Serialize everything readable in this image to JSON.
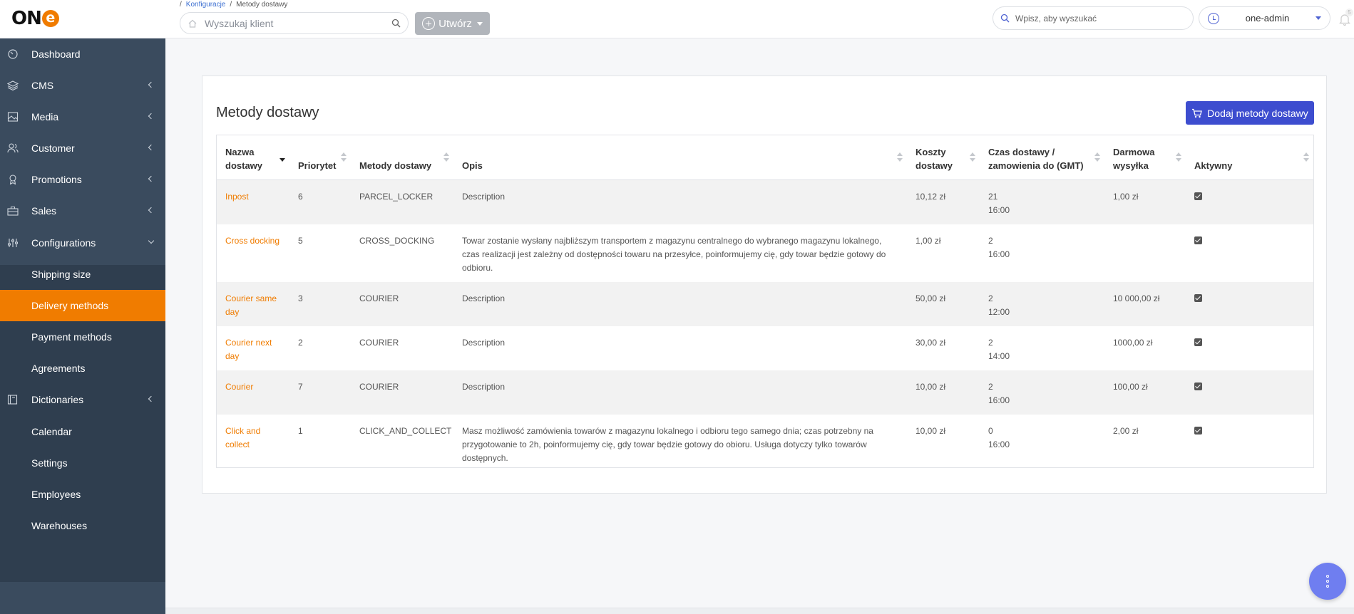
{
  "brand": {
    "logo_text": "ON",
    "logo_e": "e",
    "accent": "#f07c00",
    "primary": "#3d4dcf"
  },
  "breadcrumb": {
    "sep1": "/",
    "link": "Konfiguracje",
    "sep2": "/",
    "current": "Metody dostawy"
  },
  "header": {
    "client_search_placeholder": "Wyszukaj klient",
    "create_label": "Utwórz",
    "global_search_placeholder": "Wpisz, aby wyszukać",
    "user_name": "one-admin",
    "notification_count": "5"
  },
  "sidebar": {
    "items": [
      {
        "label": "Dashboard",
        "icon": "dashboard-icon"
      },
      {
        "label": "CMS",
        "icon": "layers-icon"
      },
      {
        "label": "Media",
        "icon": "image-icon"
      },
      {
        "label": "Customer",
        "icon": "users-icon"
      },
      {
        "label": "Promotions",
        "icon": "award-icon"
      },
      {
        "label": "Sales",
        "icon": "briefcase-icon"
      },
      {
        "label": "Configurations",
        "icon": "sliders-icon"
      },
      {
        "label": "Shipping size"
      },
      {
        "label": "Delivery methods"
      },
      {
        "label": "Payment methods"
      },
      {
        "label": "Agreements"
      },
      {
        "label": "Dictionaries",
        "icon": "book-icon"
      },
      {
        "label": "Calendar"
      },
      {
        "label": "Settings"
      },
      {
        "label": "Employees"
      },
      {
        "label": "Warehouses"
      }
    ]
  },
  "page": {
    "title": "Metody dostawy",
    "add_button": "Dodaj metody dostawy"
  },
  "table": {
    "columns": [
      "Nazwa dostawy",
      "Priorytet",
      "Metody dostawy",
      "Opis",
      "Koszty dostawy",
      "Czas dostawy / zamowienia do (GMT)",
      "Darmowa wysyłka",
      "Aktywny"
    ],
    "rows": [
      {
        "name": "Inpost",
        "priority": "6",
        "method": "PARCEL_LOCKER",
        "description": "Description",
        "cost": "10,12 zł",
        "days": "21",
        "time": "16:00",
        "free": "1,00 zł",
        "active": true
      },
      {
        "name": "Cross docking",
        "priority": "5",
        "method": "CROSS_DOCKING",
        "description": "Towar zostanie wysłany najbliższym transportem z magazynu centralnego do wybranego magazynu lokalnego, czas realizacji jest zależny od dostępności towaru na przesyłce, poinformujemy cię, gdy towar będzie gotowy do odbioru.",
        "cost": "1,00 zł",
        "days": "2",
        "time": "16:00",
        "free": "",
        "active": true
      },
      {
        "name": "Courier same day",
        "priority": "3",
        "method": "COURIER",
        "description": "Description",
        "cost": "50,00 zł",
        "days": "2",
        "time": "12:00",
        "free": "10 000,00 zł",
        "active": true
      },
      {
        "name": "Courier next day",
        "priority": "2",
        "method": "COURIER",
        "description": "Description",
        "cost": "30,00 zł",
        "days": "2",
        "time": "14:00",
        "free": "1000,00 zł",
        "active": true
      },
      {
        "name": "Courier",
        "priority": "7",
        "method": "COURIER",
        "description": "Description",
        "cost": "10,00 zł",
        "days": "2",
        "time": "16:00",
        "free": "100,00 zł",
        "active": true
      },
      {
        "name": "Click and collect",
        "priority": "1",
        "method": "CLICK_AND_COLLECT",
        "description": "Masz możliwość zamówienia towarów z magazynu lokalnego i odbioru tego samego dnia; czas potrzebny na przygotowanie to 2h, poinformujemy cię, gdy towar będzie gotowy do obioru. Usługa dotyczy tylko towarów dostępnych.",
        "cost": "10,00 zł",
        "days": "0",
        "time": "16:00",
        "free": "2,00 zł",
        "active": true
      }
    ]
  }
}
